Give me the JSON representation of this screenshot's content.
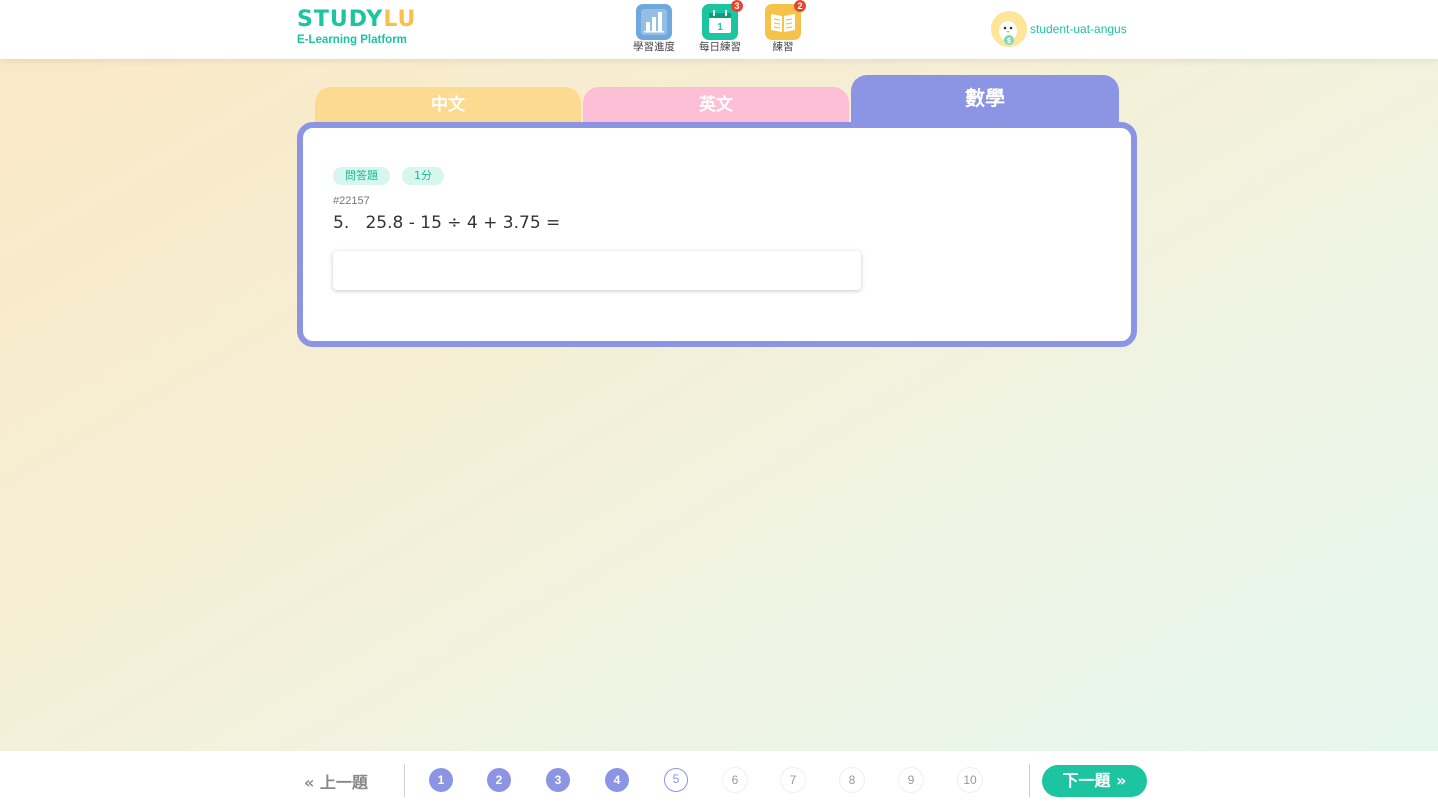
{
  "header": {
    "logo": {
      "part1": "STUDY",
      "part2": "LU",
      "subtitle": "E-Learning Platform"
    },
    "nav": [
      {
        "label": "學習進度",
        "icon": "bar-chart-icon",
        "color": "#6fa8dc"
      },
      {
        "label": "每日練習",
        "icon": "calendar-icon",
        "color": "#1cc4a0",
        "badge": "3",
        "calendar_day": "1"
      },
      {
        "label": "練習",
        "icon": "book-icon",
        "color": "#f6c34a",
        "badge": "2"
      }
    ],
    "user": {
      "name": "student-uat-angus",
      "avatar_icon": "chick-avatar-icon",
      "coin_symbol": "$"
    }
  },
  "tabs": [
    {
      "label": "中文",
      "color": "#fcda8f"
    },
    {
      "label": "英文",
      "color": "#fcbfd5"
    },
    {
      "label": "數學",
      "color": "#8c95e4",
      "active": true
    }
  ],
  "question": {
    "type_tag": "問答題",
    "score_tag": "1分",
    "id": "#22157",
    "number": "5.",
    "text": "25.8 - 15 ÷ 4 + 3.75 =",
    "answer_value": ""
  },
  "footer": {
    "prev_label": "上一題",
    "next_label": "下一題",
    "pages": [
      "1",
      "2",
      "3",
      "4",
      "5",
      "6",
      "7",
      "8",
      "9",
      "10"
    ],
    "completed_pages": [
      "1",
      "2",
      "3",
      "4"
    ],
    "current_page": "5"
  },
  "colors": {
    "accent_green": "#1cc4a0",
    "accent_purple": "#8c95e4",
    "badge_red": "#e8462e"
  }
}
